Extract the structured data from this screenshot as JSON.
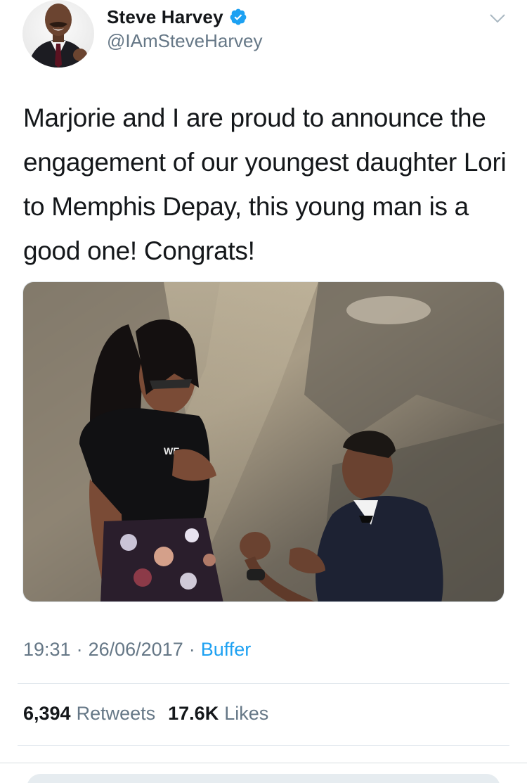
{
  "tweet": {
    "author": {
      "display_name": "Steve Harvey",
      "handle": "@IAmSteveHarvey",
      "verified": true,
      "verified_icon": "verified-badge-icon",
      "avatar_icon": "profile-avatar"
    },
    "text": "Marjorie and I are proud to announce the engagement of our youngest daughter Lori to Memphis Depay, this young man is a good one! Congrats!",
    "media": {
      "type": "photo",
      "shirt_text": "WE ... NISIS"
    },
    "meta": {
      "time": "19:31",
      "date": "26/06/2017",
      "separator": "·",
      "source": "Buffer"
    },
    "stats": {
      "retweets_count": "6,394",
      "retweets_label": "Retweets",
      "likes_count": "17.6K",
      "likes_label": "Likes"
    }
  },
  "colors": {
    "text_primary": "#14171a",
    "text_secondary": "#657786",
    "accent": "#1da1f2",
    "divider": "#e1e8ed"
  }
}
